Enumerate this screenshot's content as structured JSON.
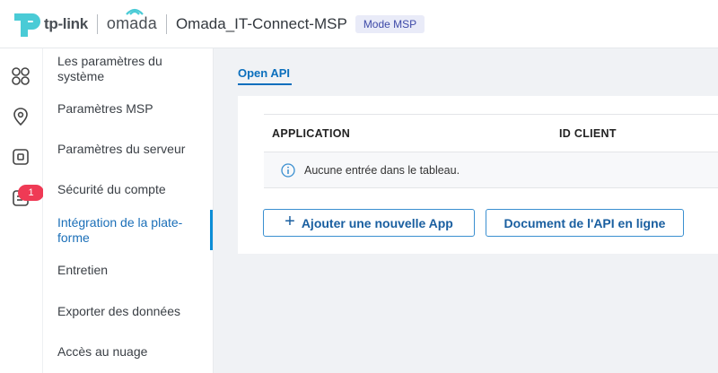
{
  "header": {
    "brand_tplink": "tp-link",
    "brand_omada": "omada",
    "site_name": "Omada_IT-Connect-MSP",
    "mode_badge": "Mode MSP"
  },
  "rail": {
    "items": [
      {
        "icon": "dashboard-grid-icon"
      },
      {
        "icon": "location-pin-icon"
      },
      {
        "icon": "device-icon"
      },
      {
        "icon": "notifications-icon",
        "badge": "1"
      }
    ],
    "badge_color": "#ef3a55"
  },
  "menu": {
    "items": [
      {
        "label": "Les paramètres du système"
      },
      {
        "label": "Paramètres MSP"
      },
      {
        "label": "Paramètres du serveur"
      },
      {
        "label": "Sécurité du compte"
      },
      {
        "label": "Intégration de la plate-forme",
        "active": true
      },
      {
        "label": "Entretien"
      },
      {
        "label": "Exporter des données"
      },
      {
        "label": "Accès au nuage"
      }
    ]
  },
  "content": {
    "tab_label": "Open API",
    "table": {
      "columns": [
        "APPLICATION",
        "ID CLIENT"
      ],
      "empty_message": "Aucune entrée dans le tableau."
    },
    "buttons": {
      "add_app": "Ajouter une nouvelle App",
      "api_doc": "Document de l'API en ligne"
    }
  },
  "colors": {
    "accent": "#0b6fbd",
    "active_bar": "#0c8dd6",
    "brand_teal": "#4acbd6"
  }
}
